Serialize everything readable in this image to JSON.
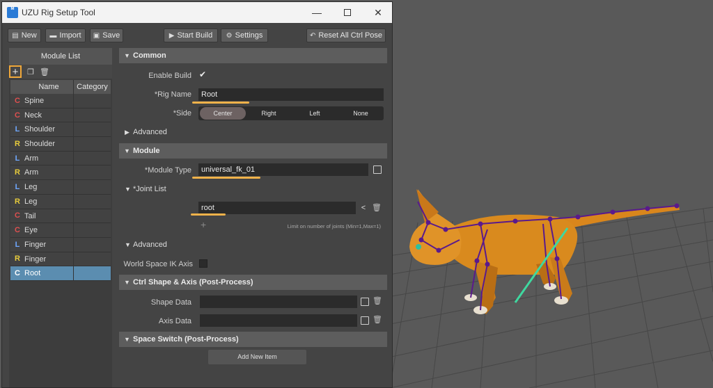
{
  "window": {
    "title": "UZU Rig Setup Tool",
    "icon_text": "M"
  },
  "toolbar": {
    "new_label": "New",
    "import_label": "Import",
    "save_label": "Save",
    "start_build_label": "Start Build",
    "settings_label": "Settings",
    "reset_label": "Reset All Ctrl Pose"
  },
  "module_list": {
    "title": "Module List",
    "columns": {
      "name": "Name",
      "category": "Category"
    },
    "rows": [
      {
        "side": "C",
        "name": "Spine"
      },
      {
        "side": "C",
        "name": "Neck"
      },
      {
        "side": "L",
        "name": "Shoulder"
      },
      {
        "side": "R",
        "name": "Shoulder"
      },
      {
        "side": "L",
        "name": "Arm"
      },
      {
        "side": "R",
        "name": "Arm"
      },
      {
        "side": "L",
        "name": "Leg"
      },
      {
        "side": "R",
        "name": "Leg"
      },
      {
        "side": "C",
        "name": "Tail"
      },
      {
        "side": "C",
        "name": "Eye"
      },
      {
        "side": "L",
        "name": "Finger"
      },
      {
        "side": "R",
        "name": "Finger"
      },
      {
        "side": "C",
        "name": "Root"
      }
    ],
    "selected_index": 12
  },
  "side_colors": {
    "C": "#e05050",
    "L": "#6fa8ff",
    "R": "#e8cc3c"
  },
  "common": {
    "header": "Common",
    "enable_build_label": "Enable Build",
    "enable_build_checked": true,
    "rig_name_label": "*Rig Name",
    "rig_name_value": "Root",
    "side_label": "*Side",
    "side_options": [
      "Center",
      "Right",
      "Left",
      "None"
    ],
    "side_selected": "Center",
    "advanced_label": "Advanced"
  },
  "module": {
    "header": "Module",
    "module_type_label": "*Module Type",
    "module_type_value": "universal_fk_01",
    "joint_list_label": "*Joint List",
    "joint_value": "root",
    "joint_limit_text": "Limit on number of joints (Min=1,Max=1)",
    "advanced_label": "Advanced",
    "world_space_label": "World Space IK Axis",
    "world_space_checked": false
  },
  "ctrl_shape": {
    "header": "Ctrl Shape & Axis (Post-Process)",
    "shape_data_label": "Shape Data",
    "axis_data_label": "Axis Data"
  },
  "space_switch": {
    "header": "Space Switch (Post-Process)",
    "add_item_label": "Add New Item"
  },
  "colors": {
    "highlight": "#f0b24a",
    "selected_row": "#5b8db0"
  }
}
